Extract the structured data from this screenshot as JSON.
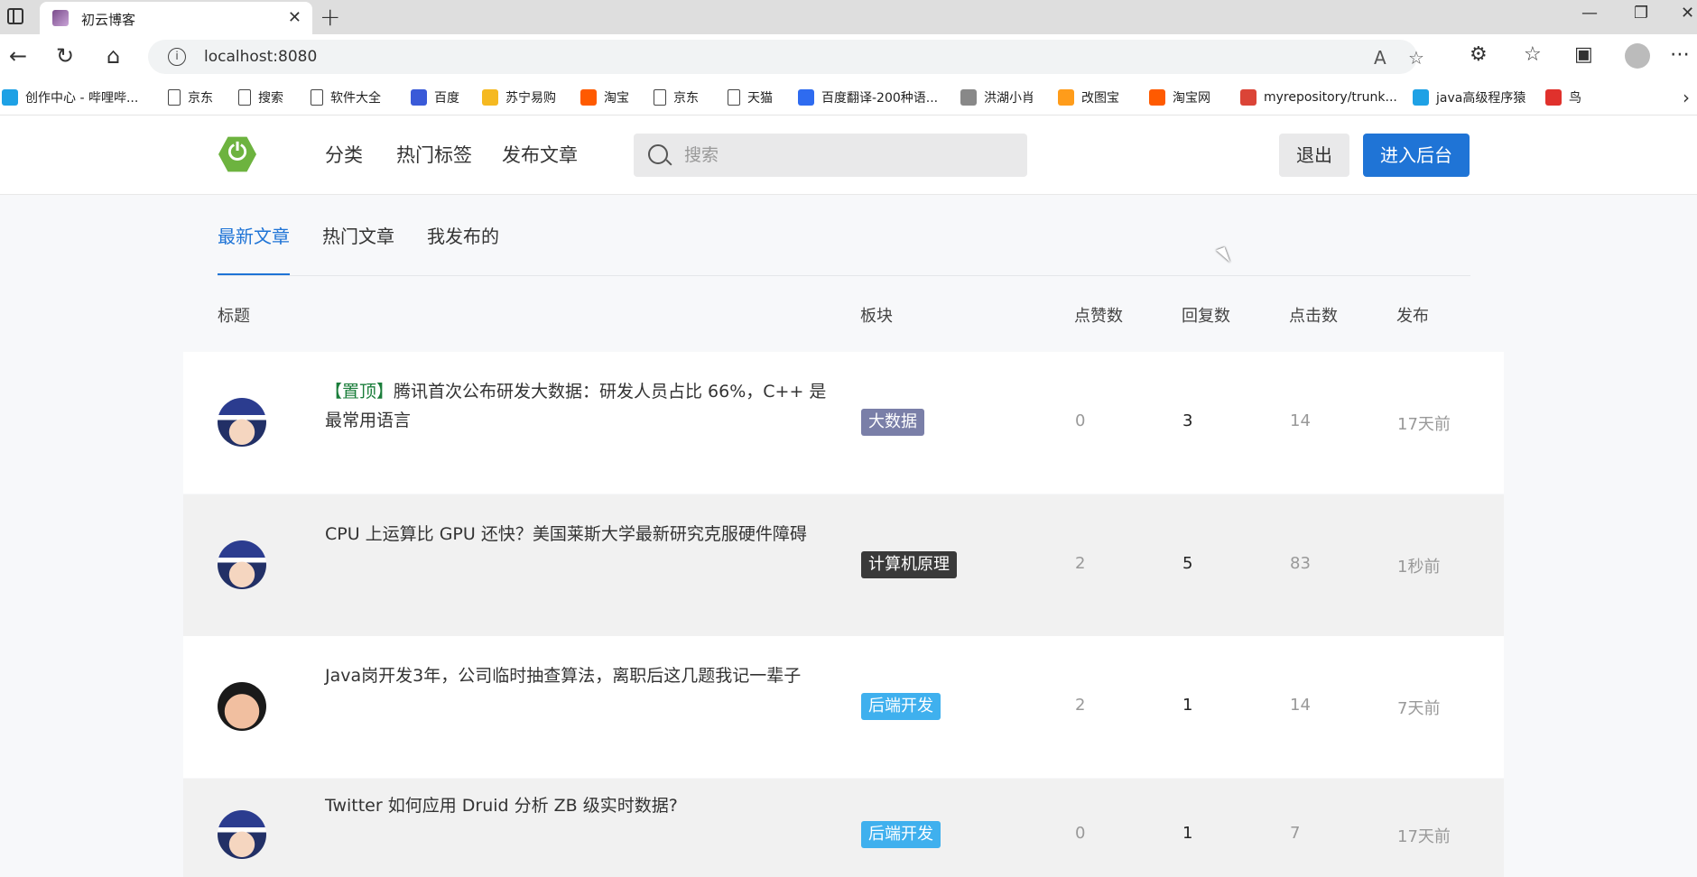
{
  "browser": {
    "tab_title": "初云博客",
    "url": "localhost:8080",
    "bookmarks": [
      {
        "label": "创作中心 - 哔哩哔...",
        "icon": "bilibili-icon",
        "color": "#1ea1e5"
      },
      {
        "label": "京东",
        "icon": "page-icon"
      },
      {
        "label": "搜索",
        "icon": "page-icon"
      },
      {
        "label": "软件大全",
        "icon": "page-icon"
      },
      {
        "label": "百度",
        "icon": "baidu-icon",
        "color": "#3a5ad8"
      },
      {
        "label": "苏宁易购",
        "icon": "suning-icon",
        "color": "#f5b921"
      },
      {
        "label": "淘宝",
        "icon": "taobao-icon",
        "color": "#ff5a00"
      },
      {
        "label": "京东",
        "icon": "page-icon"
      },
      {
        "label": "天猫",
        "icon": "page-icon"
      },
      {
        "label": "百度翻译-200种语...",
        "icon": "translate-icon",
        "color": "#2e6bf0"
      },
      {
        "label": "洪湖小肖",
        "icon": "user-icon",
        "color": "#888"
      },
      {
        "label": "改图宝",
        "icon": "gaitubao-icon",
        "color": "#ff9c1a"
      },
      {
        "label": "淘宝网",
        "icon": "taobao-icon",
        "color": "#ff5a00"
      },
      {
        "label": "myrepository/trunk...",
        "icon": "chrome-icon",
        "color": "#db4437"
      },
      {
        "label": "java高级程序猿",
        "icon": "bilibili-icon",
        "color": "#1ea1e5"
      },
      {
        "label": "鸟",
        "icon": "bird-icon",
        "color": "#e0312c"
      }
    ]
  },
  "header": {
    "nav": [
      "分类",
      "热门标签",
      "发布文章"
    ],
    "search_placeholder": "搜索",
    "logout": "退出",
    "admin": "进入后台"
  },
  "tabs": [
    "最新文章",
    "热门文章",
    "我发布的"
  ],
  "table": {
    "headers": [
      "标题",
      "板块",
      "点赞数",
      "回复数",
      "点击数",
      "发布"
    ],
    "rows": [
      {
        "pin": "【置顶】",
        "title": "腾讯首次公布研发大数据：研发人员占比 66%，C++ 是最常用语言",
        "tag": "大数据",
        "tag_color": "#7a7fa8",
        "likes": "0",
        "replies": "3",
        "clicks": "14",
        "time": "17天前",
        "avatar": "kid"
      },
      {
        "pin": "",
        "title": "CPU 上运算比 GPU 还快？美国莱斯大学最新研究克服硬件障碍",
        "tag": "计算机原理",
        "tag_color": "#3a3a3a",
        "likes": "2",
        "replies": "5",
        "clicks": "83",
        "time": "1秒前",
        "avatar": "kid"
      },
      {
        "pin": "",
        "title": "Java岗开发3年，公司临时抽查算法，离职后这几题我记一辈子",
        "tag": "后端开发",
        "tag_color": "#3fb0ee",
        "likes": "2",
        "replies": "1",
        "clicks": "14",
        "time": "7天前",
        "avatar": "shin"
      },
      {
        "pin": "",
        "title": "Twitter 如何应用 Druid 分析 ZB 级实时数据?",
        "tag": "后端开发",
        "tag_color": "#3fb0ee",
        "likes": "0",
        "replies": "1",
        "clicks": "7",
        "time": "17天前",
        "avatar": "kid"
      }
    ]
  }
}
